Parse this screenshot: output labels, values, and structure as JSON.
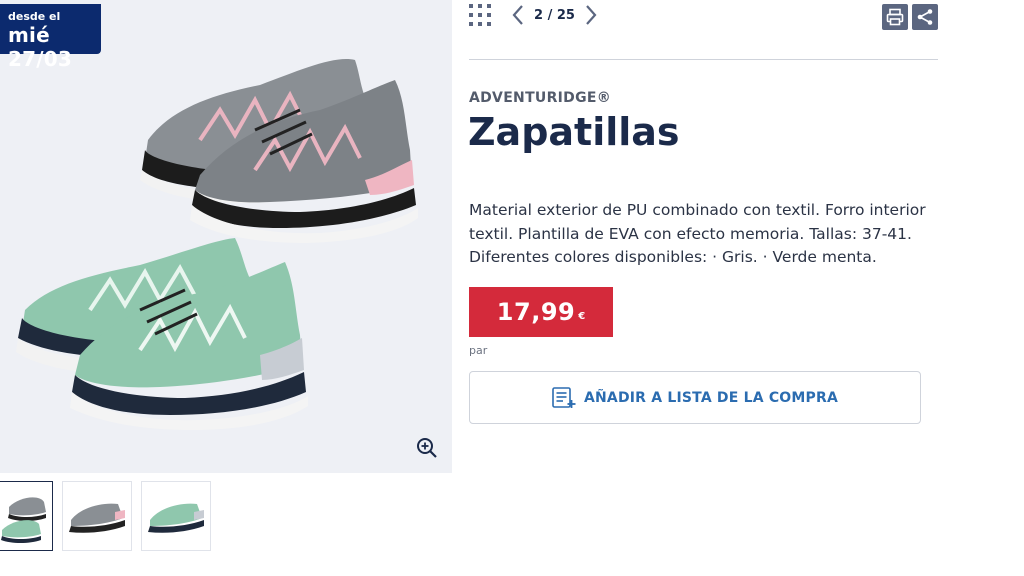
{
  "badge": {
    "line1": "desde el",
    "line2": "mié 27/03"
  },
  "pager": {
    "current": "2 / 25"
  },
  "product": {
    "brand": "ADVENTURIDGE®",
    "title": "Zapatillas",
    "description": "Material exterior de PU combinado con textil. Forro interior textil. Plantilla de EVA con efecto memoria. Tallas: 37-41. Diferentes colores disponibles: · Gris. · Verde menta."
  },
  "price": {
    "value": "17,99",
    "currency": "€",
    "unit": "par"
  },
  "actions": {
    "add_to_list": "AÑADIR A LISTA DE LA COMPRA"
  },
  "icons": {
    "grid": "grid-icon",
    "prev": "chevron-left-icon",
    "next": "chevron-right-icon",
    "print": "print-icon",
    "share": "share-icon",
    "zoom": "zoom-in-icon",
    "list": "shopping-list-icon"
  },
  "colors": {
    "navy": "#0c2a6e",
    "price_red": "#d42a3b",
    "link_blue": "#2b6cb0",
    "shoe_grey": "#8a8f94",
    "shoe_mint": "#8fc7ad"
  }
}
